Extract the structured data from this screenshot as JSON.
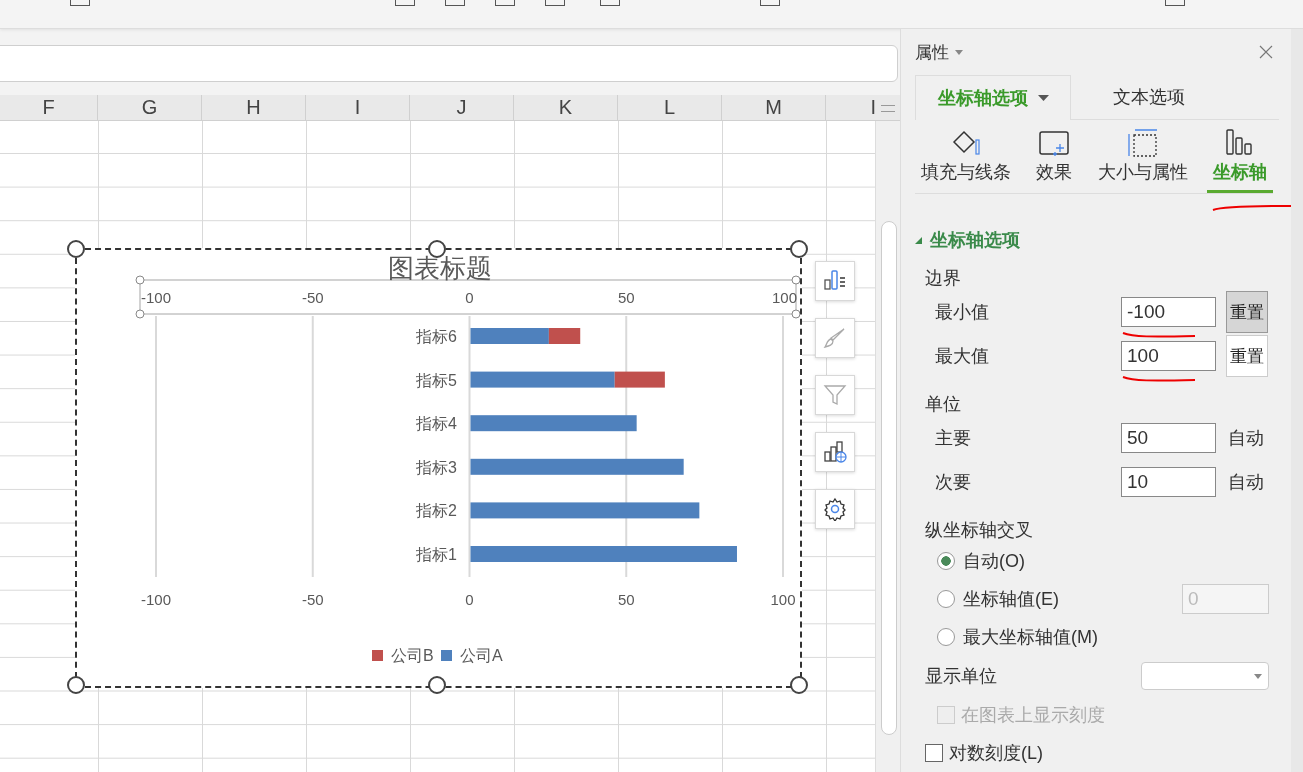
{
  "sheet": {
    "columns": [
      "F",
      "G",
      "H",
      "I",
      "J",
      "K",
      "L",
      "M",
      "I"
    ]
  },
  "chart": {
    "chart_data": {
      "type": "bar",
      "orientation": "horizontal",
      "stacked": true,
      "grid": true,
      "title": "图表标题",
      "categories": [
        "指标6",
        "指标5",
        "指标4",
        "指标3",
        "指标2",
        "指标1"
      ],
      "series": [
        {
          "name": "公司A",
          "color": "#4f81bd",
          "values": [
            25,
            46,
            53,
            68,
            73,
            85
          ]
        },
        {
          "name": "公司B",
          "color": "#c0504d",
          "values": [
            10,
            16,
            0,
            0,
            0,
            0
          ]
        }
      ],
      "legend": true,
      "xlim": [
        -100,
        100
      ],
      "xticks": [
        {
          "value": -100,
          "label": "-100"
        },
        {
          "value": -50,
          "label": "-50"
        },
        {
          "value": 0,
          "label": "0"
        },
        {
          "value": 50,
          "label": "50"
        },
        {
          "value": 100,
          "label": "100"
        }
      ]
    },
    "top_axis": {
      "labels": [
        "-100",
        "-50",
        "0",
        "50",
        "100"
      ]
    },
    "side_buttons": [
      {
        "kind": "elements"
      },
      {
        "kind": "style"
      },
      {
        "kind": "filter"
      },
      {
        "kind": "online"
      },
      {
        "kind": "settings"
      }
    ]
  },
  "panel": {
    "title": "属性",
    "tabs": [
      {
        "label": "坐标轴选项",
        "selected": true,
        "dropdown": true
      },
      {
        "label": "文本选项",
        "selected": false,
        "dropdown": false
      }
    ],
    "icon_tabs": [
      {
        "kind": "fill",
        "label": "填充与线条",
        "selected": false,
        "marked": false
      },
      {
        "kind": "effect",
        "label": "效果",
        "selected": false,
        "marked": false
      },
      {
        "kind": "size",
        "label": "大小与属性",
        "selected": false,
        "marked": false
      },
      {
        "kind": "axis",
        "label": "坐标轴",
        "selected": true,
        "marked": true
      }
    ],
    "section": {
      "title": "坐标轴选项",
      "expanded": true
    },
    "groups": [
      {
        "label": "边界",
        "rows": [
          {
            "label": "最小值",
            "value": "-100",
            "action": "重置",
            "kind": "button",
            "pressed": true,
            "marked": true
          },
          {
            "label": "最大值",
            "value": "100",
            "action": "重置",
            "kind": "button",
            "pressed": false,
            "marked": true
          }
        ]
      },
      {
        "label": "单位",
        "rows": [
          {
            "label": "主要",
            "value": "50",
            "action": "自动",
            "kind": "text"
          },
          {
            "label": "次要",
            "value": "10",
            "action": "自动",
            "kind": "text"
          }
        ]
      }
    ],
    "cross": {
      "label": "纵坐标轴交叉",
      "options": [
        {
          "label": "自动(O)",
          "selected": true
        },
        {
          "label": "坐标轴值(E)",
          "selected": false,
          "field": "0"
        },
        {
          "label": "最大坐标轴值(M)",
          "selected": false
        }
      ]
    },
    "display_unit": {
      "label": "显示单位"
    },
    "checks": [
      {
        "label": "在图表上显示刻度",
        "checked": false,
        "disabled": true
      },
      {
        "label": "对数刻度(L)",
        "checked": false,
        "disabled": false
      }
    ]
  }
}
